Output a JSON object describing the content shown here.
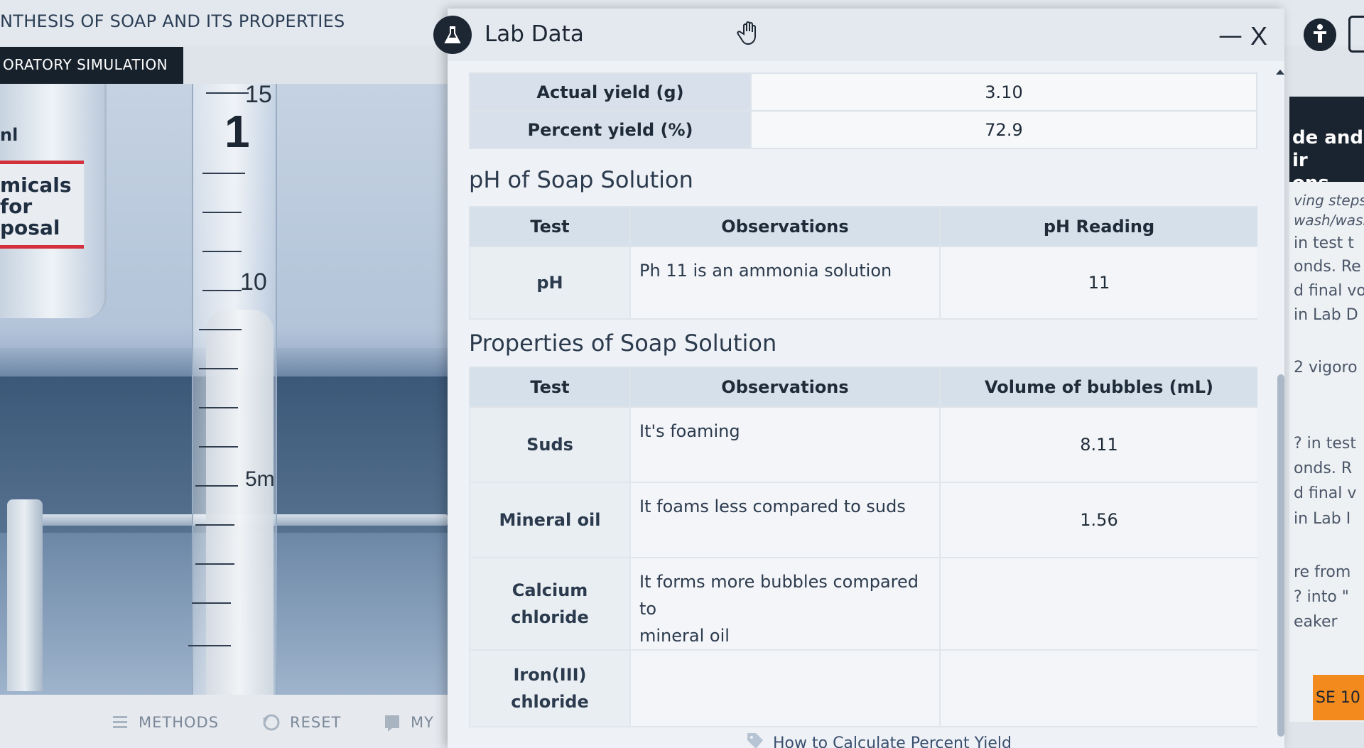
{
  "app": {
    "title": "NTHESIS OF SOAP AND ITS PROPERTIES",
    "badge": "ORATORY SIMULATION"
  },
  "scene": {
    "chem_tab": "nl",
    "chem_label": "micals\nfor\nposal",
    "scale": {
      "big": "1",
      "n15": "15",
      "n10": "10",
      "n5": "5m"
    }
  },
  "bottom_bar": {
    "methods": "METHODS",
    "reset": "RESET",
    "my": "MY"
  },
  "dialog": {
    "title": "Lab Data",
    "minimize": "—",
    "close": "X",
    "icons": {
      "badge": "flask-icon",
      "drag": "hand-icon"
    }
  },
  "yield_table": [
    {
      "label": "Actual yield (g)",
      "value": "3.10"
    },
    {
      "label": "Percent yield (%)",
      "value": "72.9"
    }
  ],
  "ph_section": {
    "title": "pH of Soap Solution",
    "headers": [
      "Test",
      "Observations",
      "pH Reading"
    ],
    "rows": [
      {
        "test": "pH",
        "observation": "Ph 11 is an ammonia solution",
        "reading": "11"
      }
    ]
  },
  "properties_section": {
    "title": "Properties of Soap Solution",
    "headers": [
      "Test",
      "Observations",
      "Volume of bubbles (mL)"
    ],
    "rows": [
      {
        "test": "Suds",
        "observation": "It's foaming",
        "volume": "8.11"
      },
      {
        "test": "Mineral oil",
        "observation": "It foams less compared to suds",
        "volume": "1.56"
      },
      {
        "test": "Calcium\nchloride",
        "observation": "It forms more bubbles compared to\nmineral oil",
        "volume": ""
      },
      {
        "test": "Iron(III)\nchloride",
        "observation": "",
        "volume": ""
      }
    ]
  },
  "help_link": "How to Calculate Percent Yield",
  "right_panel": {
    "heading": "de and ir\nons",
    "lines": [
      "ving steps",
      "wash/wasl",
      "in test t",
      "onds. Re",
      "d final vo",
      "in Lab D",
      "2 vigoro",
      "? in test",
      "onds. R",
      "d final v",
      "in Lab I",
      "re from",
      "? into \"",
      "eaker"
    ],
    "orange": "SE 10",
    "access_icon": "accessibility-icon"
  },
  "colors": {
    "header_dark": "#1d2734",
    "table_header": "#d6e0ea",
    "accent_orange": "#f28a1d",
    "danger_red": "#d3303c"
  }
}
